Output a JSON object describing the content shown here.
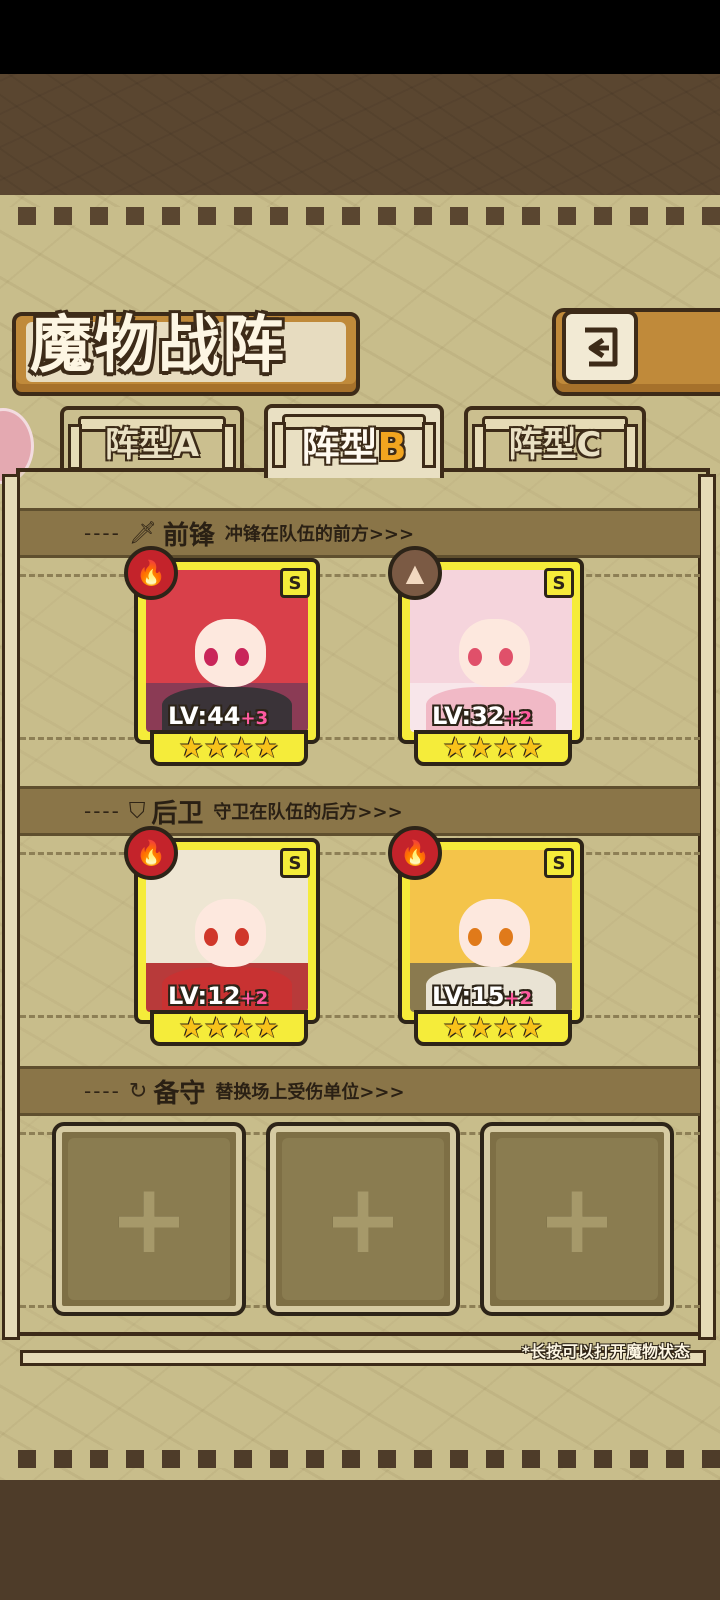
{
  "header": {
    "title": "魔物战阵"
  },
  "tabs": [
    {
      "label": "阵型A",
      "active": false
    },
    {
      "label": "阵型",
      "suffix": "B",
      "active": true
    },
    {
      "label": "阵型C",
      "active": false
    }
  ],
  "sections": {
    "front": {
      "title": "前锋",
      "desc": "冲锋在队伍的前方>>>",
      "dash": "----",
      "icon": "sword-icon"
    },
    "rear": {
      "title": "后卫",
      "desc": "守卫在队伍的后方>>>",
      "dash": "----",
      "icon": "shield-icon"
    },
    "bench": {
      "title": "备守",
      "desc": "替换场上受伤单位>>>",
      "dash": "----",
      "icon": "swap-icon"
    }
  },
  "units": [
    {
      "rank": "S",
      "element": "fire",
      "level": "LV:44",
      "bonus": "+3",
      "stars": 4,
      "hair": "#d9404a",
      "eyes": "#c9265a",
      "body": "#3a3338"
    },
    {
      "rank": "S",
      "element": "earth",
      "level": "LV:32",
      "bonus": "+2",
      "stars": 4,
      "hair": "#f5d4dc",
      "eyes": "#e0506a",
      "body": "#f1b9c6"
    },
    {
      "rank": "S",
      "element": "fire",
      "level": "LV:12",
      "bonus": "+2",
      "stars": 4,
      "hair": "#eee6d3",
      "eyes": "#d0372a",
      "body": "#c83232"
    },
    {
      "rank": "S",
      "element": "fire",
      "level": "LV:15",
      "bonus": "+2",
      "stars": 4,
      "hair": "#f4c44a",
      "eyes": "#e07a1a",
      "body": "#e9e3d4"
    }
  ],
  "bench_slots": [
    "+",
    "+",
    "+"
  ],
  "footer": {
    "note": "*长按可以打开魔物状态"
  },
  "colors": {
    "card_yellow": "#f5ec3a",
    "fire": "#c4232b",
    "earth": "#7b5a44",
    "panel": "#c8bd8b"
  }
}
